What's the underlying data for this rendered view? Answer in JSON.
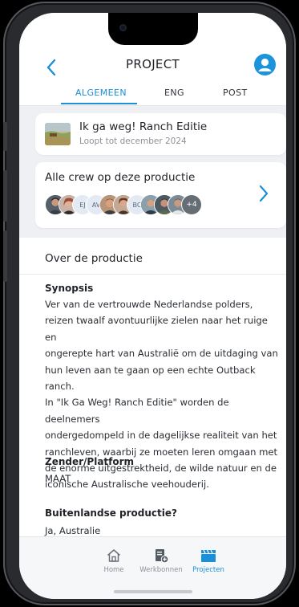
{
  "header": {
    "title": "PROJECT",
    "accent": "#1c8fd9"
  },
  "tabs": [
    {
      "label": "ALGEMEEN",
      "active": true
    },
    {
      "label": "ENG",
      "active": false
    },
    {
      "label": "POST",
      "active": false
    }
  ],
  "production": {
    "title": "Ik ga weg! Ranch Editie",
    "subtitle": "Loopt tot december 2024"
  },
  "crew": {
    "title": "Alle crew op deze productie",
    "avatars": [
      {
        "initials": "",
        "kind": "photo",
        "color": "#7a6655"
      },
      {
        "initials": "",
        "kind": "photo",
        "color": "#a76a5a"
      },
      {
        "initials": "EJ",
        "kind": "initials",
        "color": "#e3eaf3"
      },
      {
        "initials": "AV",
        "kind": "initials",
        "color": "#e3eaf3"
      },
      {
        "initials": "",
        "kind": "photo",
        "color": "#8a5c44"
      },
      {
        "initials": "",
        "kind": "photo",
        "color": "#6d4c3d"
      },
      {
        "initials": "BC",
        "kind": "initials",
        "color": "#e3eaf3"
      },
      {
        "initials": "",
        "kind": "photo",
        "color": "#5c7080"
      },
      {
        "initials": "",
        "kind": "photo",
        "color": "#3d4a55"
      },
      {
        "initials": "",
        "kind": "photo",
        "color": "#6e7b86"
      }
    ],
    "more": "+4"
  },
  "about": {
    "section_title": "Over de productie",
    "synopsis_label": "Synopsis",
    "synopsis_lines": [
      "Ver van de vertrouwde Nederlandse polders,",
      "reizen twaalf avontuurlijke zielen naar het ruige en",
      "ongerepte hart van Australië om de uitdaging van",
      "hun leven aan te gaan op een echte Outback ranch.",
      "In \"Ik Ga Weg! Ranch Editie\" worden de deelnemers",
      "ondergedompeld in de dagelijkse realiteit van het",
      "ranchleven, waarbij ze moeten leren omgaan met",
      "de enorme uitgestrektheid, de wilde natuur en de",
      "iconische Australische veehouderij."
    ],
    "broadcaster_label": "Zender/Platform",
    "broadcaster_value": "MAAT",
    "foreign_label": "Buitenlandse productie?",
    "foreign_value": "Ja, Australie"
  },
  "nav": [
    {
      "label": "Home",
      "icon": "home-icon",
      "active": false
    },
    {
      "label": "Werkbonnen",
      "icon": "document-add-icon",
      "active": false
    },
    {
      "label": "Projecten",
      "icon": "clapperboard-icon",
      "active": true
    }
  ]
}
